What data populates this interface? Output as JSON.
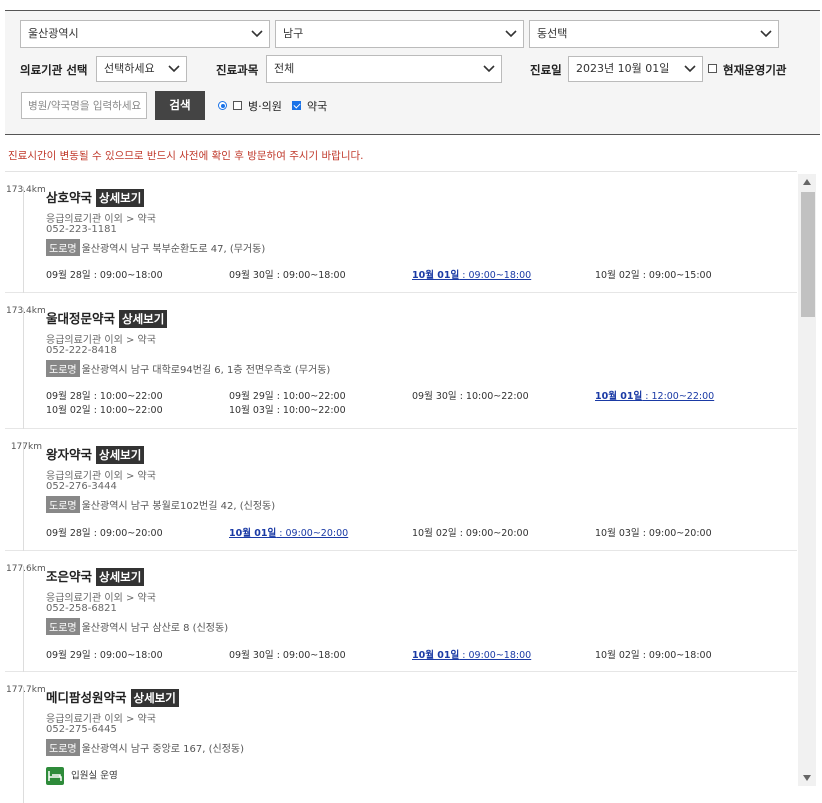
{
  "filters": {
    "region1": "울산광역시",
    "region2": "남구",
    "region3": "동선택",
    "institution_label": "의료기관 선택",
    "institution_value": "선택하세요",
    "dept_label": "진료과목",
    "dept_value": "전체",
    "date_label": "진료일",
    "date_value": "2023년 10월 01일",
    "open_now_label": "현재운영기관",
    "search_placeholder": "병원/약국명을 입력하세요",
    "search_button": "검색",
    "hospital_label": "병·의원",
    "pharmacy_label": "약국"
  },
  "notice": "진료시간이 변동될 수 있으므로 반드시 사전에 확인 후 방문하여 주시기 바랍니다.",
  "common": {
    "detail_button": "상세보기",
    "road_badge": "도로명",
    "ward_text": "입원실 운영"
  },
  "entries": [
    {
      "distance": "173.4km",
      "name": "삼호약국",
      "category": "응급의료기관 이외 > 약국",
      "phone": "052-223-1181",
      "address": "울산광역시 남구 북부순환도로 47, (무거동)",
      "hours": [
        {
          "day": "09월 28일",
          "time": " : 09:00~18:00",
          "today": false
        },
        {
          "day": "09월 30일",
          "time": " : 09:00~18:00",
          "today": false
        },
        {
          "day": "10월 01일",
          "time": " : 09:00~18:00",
          "today": true
        },
        {
          "day": "10월 02일",
          "time": " : 09:00~15:00",
          "today": false
        }
      ]
    },
    {
      "distance": "173.4km",
      "name": "울대정문약국",
      "category": "응급의료기관 이외 > 약국",
      "phone": "052-222-8418",
      "address": "울산광역시 남구 대학로94번길 6, 1층 전면우측호 (무거동)",
      "hours": [
        {
          "day": "09월 28일",
          "time": " : 10:00~22:00",
          "today": false
        },
        {
          "day": "09월 29일",
          "time": " : 10:00~22:00",
          "today": false
        },
        {
          "day": "09월 30일",
          "time": " : 10:00~22:00",
          "today": false
        },
        {
          "day": "10월 01일",
          "time": " : 12:00~22:00",
          "today": true
        },
        {
          "day": "10월 02일",
          "time": " : 10:00~22:00",
          "today": false
        },
        {
          "day": "10월 03일",
          "time": " : 10:00~22:00",
          "today": false
        }
      ]
    },
    {
      "distance": "177km",
      "name": "왕자약국",
      "category": "응급의료기관 이외 > 약국",
      "phone": "052-276-3444",
      "address": "울산광역시 남구 봉월로102번길 42, (신정동)",
      "hours": [
        {
          "day": "09월 28일",
          "time": " : 09:00~20:00",
          "today": false
        },
        {
          "day": "10월 01일",
          "time": " : 09:00~20:00",
          "today": true
        },
        {
          "day": "10월 02일",
          "time": " : 09:00~20:00",
          "today": false
        },
        {
          "day": "10월 03일",
          "time": " : 09:00~20:00",
          "today": false
        }
      ]
    },
    {
      "distance": "177.6km",
      "name": "조은약국",
      "category": "응급의료기관 이외 > 약국",
      "phone": "052-258-6821",
      "address": "울산광역시 남구 삼산로 8 (신정동)",
      "hours": [
        {
          "day": "09월 29일",
          "time": " : 09:00~18:00",
          "today": false
        },
        {
          "day": "09월 30일",
          "time": " : 09:00~18:00",
          "today": false
        },
        {
          "day": "10월 01일",
          "time": " : 09:00~18:00",
          "today": true
        },
        {
          "day": "10월 02일",
          "time": " : 09:00~18:00",
          "today": false
        }
      ]
    },
    {
      "distance": "177.7km",
      "name": "메디팜성원약국",
      "category": "응급의료기관 이외 > 약국",
      "phone": "052-275-6445",
      "address": "울산광역시 남구 중앙로 167, (신정동)",
      "hours": []
    }
  ]
}
